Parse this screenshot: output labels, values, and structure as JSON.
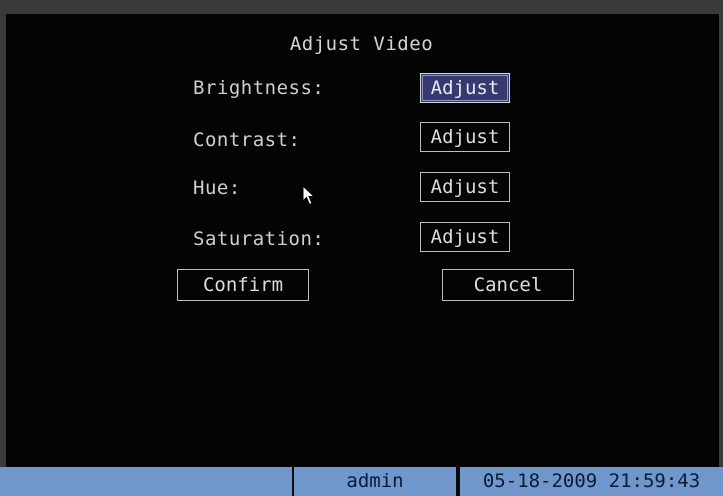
{
  "dialog": {
    "title": "Adjust Video",
    "rows": [
      {
        "label": "Brightness:",
        "button": "Adjust",
        "selected": true
      },
      {
        "label": "Contrast:",
        "button": "Adjust",
        "selected": false
      },
      {
        "label": "Hue:",
        "button": "Adjust",
        "selected": false
      },
      {
        "label": "Saturation:",
        "button": "Adjust",
        "selected": false
      }
    ],
    "confirm_label": "Confirm",
    "cancel_label": "Cancel"
  },
  "statusbar": {
    "user": "admin",
    "datetime": "05-18-2009 21:59:43"
  },
  "colors": {
    "background": "#040404",
    "text": "#d2d2d2",
    "selection": "#363a6e",
    "statusbar": "#6f97cc",
    "statusbar_text": "#0d1a33"
  },
  "icons": {
    "cursor": "mouse-pointer-icon"
  }
}
